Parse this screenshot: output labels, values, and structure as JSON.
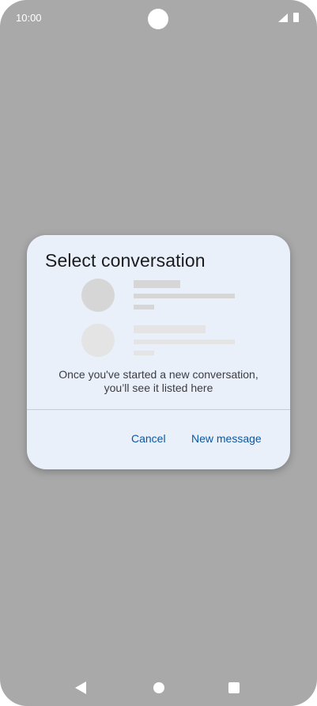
{
  "status_bar": {
    "time": "10:00",
    "signal_icon": "signal-icon",
    "battery_icon": "battery-icon"
  },
  "dialog": {
    "title": "Select conversation",
    "empty_message": "Once you've started a new conversation, you’ll see it listed here",
    "cancel_label": "Cancel",
    "new_message_label": "New message"
  },
  "nav_bar": {
    "back_icon": "back-icon",
    "home_icon": "home-icon",
    "recents_icon": "recents-icon"
  },
  "colors": {
    "scrim": "#a9a9a9",
    "dialog_background": "#e9f0fa",
    "accent": "#0b57a3",
    "placeholder_dark": "#d6d6d6",
    "placeholder_light": "#e4e4e4"
  }
}
